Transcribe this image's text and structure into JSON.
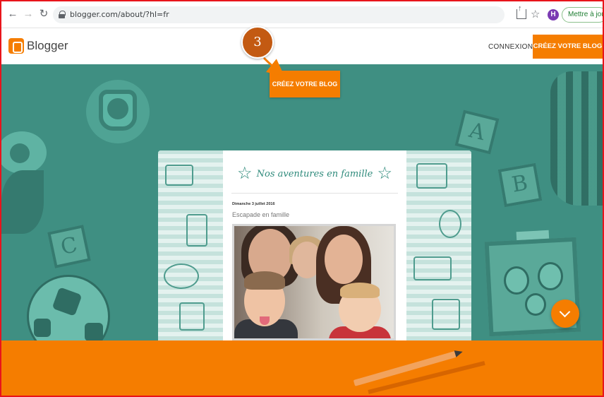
{
  "browser": {
    "url": "blogger.com/about/?hl=fr",
    "profile_initial": "H",
    "update_label": "Mettre à jour"
  },
  "header": {
    "logo_text": "Blogger",
    "login_label": "CONNEXION",
    "create_label": "CRÉEZ VOTRE BLOG"
  },
  "hero": {
    "create_label": "CRÉEZ VOTRE BLOG",
    "block_letters": [
      "C",
      "A",
      "B"
    ]
  },
  "mockup": {
    "blog_title": "Nos aventures en famille",
    "post_date": "Dimanche 3 juillet 2016",
    "post_title": "Escapade en famille"
  },
  "annotation": {
    "step_number": "3"
  },
  "colors": {
    "brand_orange": "#f57d00",
    "hero_teal": "#3f8f82",
    "annotation_badge": "#c35a12",
    "frame_border": "#e8141b"
  },
  "icons": [
    "back-arrow-icon",
    "forward-arrow-icon",
    "reload-icon",
    "lock-icon",
    "share-icon",
    "star-icon",
    "blogger-logo-icon",
    "chevron-down-icon"
  ]
}
